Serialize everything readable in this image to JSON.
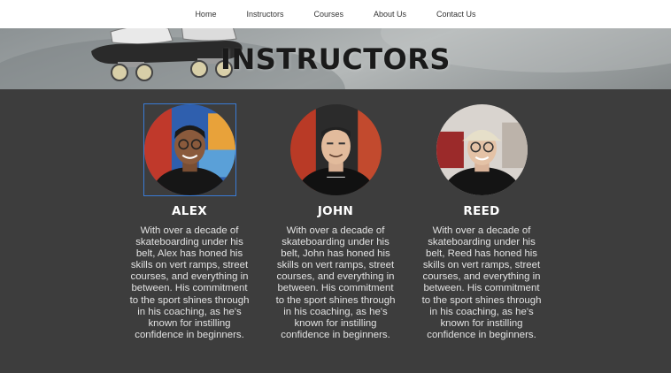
{
  "nav": {
    "items": [
      {
        "label": "Home"
      },
      {
        "label": "Instructors"
      },
      {
        "label": "Courses"
      },
      {
        "label": "About Us"
      },
      {
        "label": "Contact Us"
      }
    ]
  },
  "hero": {
    "title": "INSTRUCTORS"
  },
  "instructors": [
    {
      "name": "ALEX",
      "bio": "With over a decade of skateboarding under his belt, Alex has honed his skills on vert ramps, street courses, and everything in between. His commitment to the sport shines through in his coaching, as he's known for instilling confidence in beginners.",
      "focused": true
    },
    {
      "name": "JOHN",
      "bio": "With over a decade of skateboarding under his belt, John has honed his skills on vert ramps, street courses, and everything in between. His commitment to the sport shines through in his coaching, as he's known for instilling confidence in beginners.",
      "focused": false
    },
    {
      "name": "REED",
      "bio": "With over a decade of skateboarding under his belt, Reed has honed his skills on vert ramps, street courses, and everything in between. His commitment to the sport shines through in his coaching, as he's known for instilling confidence in beginners.",
      "focused": false
    }
  ],
  "colors": {
    "background": "#3d3d3d",
    "nav_background": "#ffffff",
    "focus_border": "#3a7bd5",
    "name_text": "#ffffff",
    "bio_text": "#e2e2e2"
  }
}
